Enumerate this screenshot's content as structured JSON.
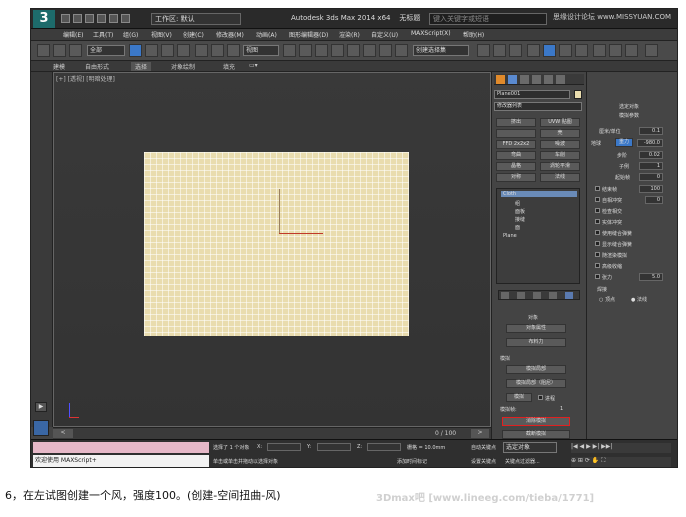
{
  "app": {
    "title": "Autodesk 3ds Max  2014 x64",
    "doc": "无标题",
    "workspace": "工作区: 默认",
    "search_placeholder": "键入关键字或短语",
    "watermark_top": "思缘设计论坛 www.MISSYUAN.COM",
    "logo_text": "3"
  },
  "menu": [
    "编辑(E)",
    "工具(T)",
    "组(G)",
    "视图(V)",
    "创建(C)",
    "修改器(M)",
    "动画(A)",
    "图形编辑器(D)",
    "渲染(R)",
    "自定义(U)",
    "MAXScript(X)",
    "帮助(H)"
  ],
  "toolbar": {
    "filter": "全部",
    "view": "视图",
    "selection_set": "创建选择集"
  },
  "ribbon": [
    "建模",
    "自由形式",
    "选择",
    "对象绘制",
    "填充"
  ],
  "viewport": {
    "label": "[+] [透视] [明暗处理]"
  },
  "timebar": {
    "frames": "0 / 100"
  },
  "mid_panel": {
    "object_name": "Plane001",
    "modifier_list": "修改器列表",
    "buttons": [
      [
        "挤出",
        "UVW 贴图"
      ],
      [
        "",
        "壳"
      ],
      [
        "FFD 2x2x2",
        "噪波"
      ],
      [
        "弯曲",
        "车削"
      ],
      [
        "晶格",
        "涡轮平滑"
      ],
      [
        "对称",
        "法线"
      ]
    ],
    "stack": [
      "Cloth",
      "组",
      "面板",
      "接缝",
      "面",
      "Plane"
    ],
    "rollout_title": "对象",
    "object_props": "对象属性",
    "object_force": "布料力",
    "sim_title": "模拟",
    "sim_local": "模拟局部",
    "sim_local_damped": "模拟局部（阻尼）",
    "simulate": "模拟",
    "progress": "进程",
    "sim_frame_label": "模拟帧:",
    "sim_frame": "1",
    "erase_sim": "消除模拟",
    "truncate_sim": "截断模拟"
  },
  "right_panel": {
    "sel_object": "选定对象",
    "sim_params": "模拟参数",
    "cm_unit": "厘米/单位",
    "cm_unit_val": "0.1",
    "earth": "地球",
    "gravity": "重力",
    "gravity_val": "-980.0",
    "step": "步阶",
    "step_val": "0.02",
    "subsample": "子例",
    "subsample_val": "1",
    "start_frame": "起始帧",
    "start_frame_val": "0",
    "end_frame": "结束帧",
    "end_frame_val": "100",
    "self_collision": "自相冲突",
    "self_collision_val": "0",
    "check_intersect": "检查相交",
    "solid_collision": "实体冲突",
    "use_sewing": "使用缝合弹簧",
    "show_sewing": "显示缝合弹簧",
    "sim_render": "随渲染模拟",
    "advanced_pinch": "高级收缩",
    "tension": "张力",
    "tension_val": "5.0",
    "weld_title": "焊接",
    "vertex": "顶点",
    "normal": "法线"
  },
  "status": {
    "script_line1": "",
    "script_line2": "欢迎使用 MAXScript+",
    "selected": "选择了 1 个对象",
    "prompt": "单击或单击并拖动以选择对象",
    "x": "X:",
    "y": "Y:",
    "z": "Z:",
    "grid": "栅格 = 10.0mm",
    "add_time_tag": "添加时间标记",
    "auto_key": "自动关键点",
    "set_key": "设置关键点",
    "selected_obj": "选定对象",
    "key_filter": "关键点过滤器..."
  },
  "caption": "6，在左试图创建一个风，强度100。(创建-空间扭曲-风)",
  "caption_wm": "3Dmax吧 [www.lineeg.com/tieba/1771]"
}
